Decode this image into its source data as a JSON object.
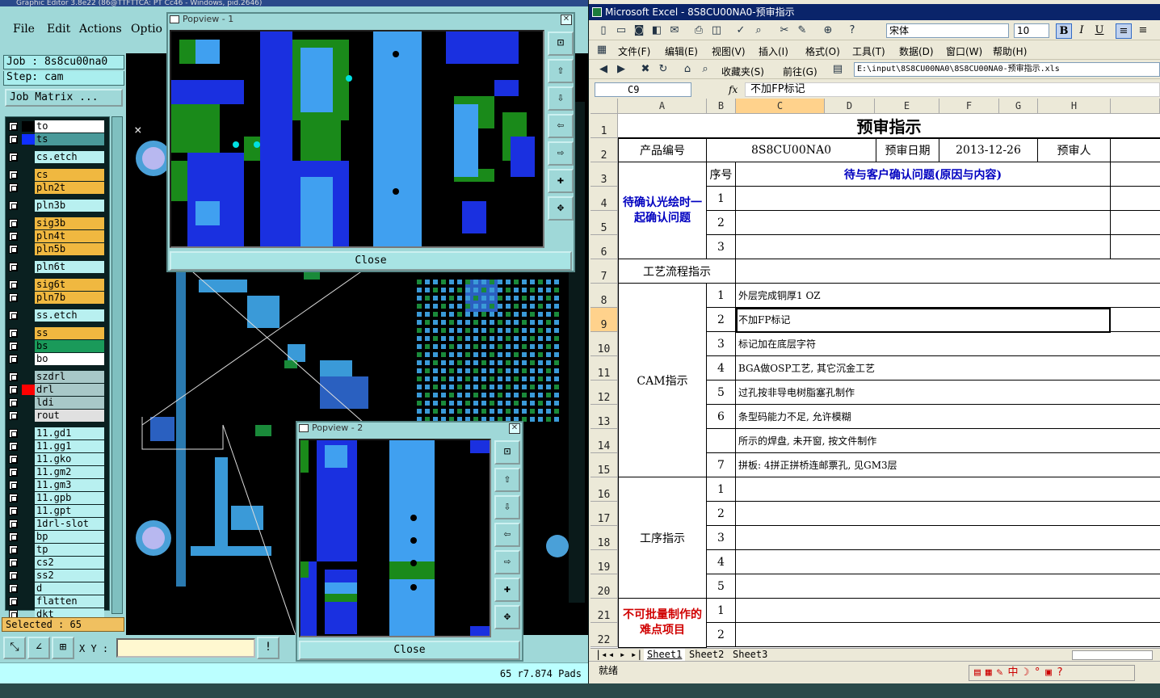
{
  "graphic_editor": {
    "title": "Graphic Editor 3.8e22 (86@TTFTTCA: PT Cc46 - Windows, pid.2646)",
    "menu": [
      "File",
      "Edit",
      "Actions",
      "Optio"
    ],
    "job_label": "Job : 8s8cu00na0",
    "step_label": "Step: cam",
    "job_matrix_button": "Job Matrix ...",
    "layers": [
      {
        "name": "to",
        "color": "#ffffff",
        "swatch": "#000000"
      },
      {
        "name": "ts",
        "color": "#4a9a9a",
        "swatch": "#1030ff"
      },
      {
        "name": "cs.etch",
        "color": "#b8f0f0",
        "swatch": ""
      },
      {
        "name": "cs",
        "color": "#f0b840",
        "swatch": ""
      },
      {
        "name": "pln2t",
        "color": "#f0b840",
        "swatch": ""
      },
      {
        "name": "pln3b",
        "color": "#b8f0f0",
        "swatch": ""
      },
      {
        "name": "sig3b",
        "color": "#f0b840",
        "swatch": ""
      },
      {
        "name": "pln4t",
        "color": "#f0b840",
        "swatch": ""
      },
      {
        "name": "pln5b",
        "color": "#f0b840",
        "swatch": ""
      },
      {
        "name": "pln6t",
        "color": "#b8f0f0",
        "swatch": ""
      },
      {
        "name": "sig6t",
        "color": "#f0b840",
        "swatch": ""
      },
      {
        "name": "pln7b",
        "color": "#f0b840",
        "swatch": ""
      },
      {
        "name": "ss.etch",
        "color": "#b8f0f0",
        "swatch": ""
      },
      {
        "name": "ss",
        "color": "#f0b840",
        "swatch": ""
      },
      {
        "name": "bs",
        "color": "#1a9a5a",
        "swatch": ""
      },
      {
        "name": "bo",
        "color": "#ffffff",
        "swatch": ""
      },
      {
        "name": "szdrl",
        "color": "#a8c8c8",
        "swatch": ""
      },
      {
        "name": "drl",
        "color": "#a8c8c8",
        "swatch": "#ff0000"
      },
      {
        "name": "ldi",
        "color": "#a8c8c8",
        "swatch": ""
      },
      {
        "name": "rout",
        "color": "#e0e0e0",
        "swatch": ""
      },
      {
        "name": "11.gd1",
        "color": "#b8f0f0",
        "swatch": ""
      },
      {
        "name": "11.gg1",
        "color": "#b8f0f0",
        "swatch": ""
      },
      {
        "name": "11.gko",
        "color": "#b8f0f0",
        "swatch": ""
      },
      {
        "name": "11.gm2",
        "color": "#b8f0f0",
        "swatch": ""
      },
      {
        "name": "11.gm3",
        "color": "#b8f0f0",
        "swatch": ""
      },
      {
        "name": "11.gpb",
        "color": "#b8f0f0",
        "swatch": ""
      },
      {
        "name": "11.gpt",
        "color": "#b8f0f0",
        "swatch": ""
      },
      {
        "name": "1drl-slot",
        "color": "#b8f0f0",
        "swatch": ""
      },
      {
        "name": "bp",
        "color": "#b8f0f0",
        "swatch": ""
      },
      {
        "name": "tp",
        "color": "#b8f0f0",
        "swatch": ""
      },
      {
        "name": "cs2",
        "color": "#b8f0f0",
        "swatch": ""
      },
      {
        "name": "ss2",
        "color": "#b8f0f0",
        "swatch": ""
      },
      {
        "name": "d",
        "color": "#b8f0f0",
        "swatch": ""
      },
      {
        "name": "flatten",
        "color": "#b8f0f0",
        "swatch": ""
      },
      {
        "name": "dkt",
        "color": "#b8f0f0",
        "swatch": ""
      }
    ],
    "selected_label": "Selected : 65",
    "xy_label": "X Y :",
    "status_text": "65 r7.874 Pads"
  },
  "popview1": {
    "title": "Popview - 1",
    "close_label": "Close"
  },
  "popview2": {
    "title": "Popview - 2",
    "close_label": "Close"
  },
  "excel": {
    "title": "Microsoft Excel - 8S8CU00NA0-预审指示",
    "menu": [
      "文件(F)",
      "编辑(E)",
      "视图(V)",
      "插入(I)",
      "格式(O)",
      "工具(T)",
      "数据(D)",
      "窗口(W)",
      "帮助(H)"
    ],
    "font_name": "宋体",
    "font_size": "10",
    "back_label": "收藏夹(S)",
    "go_label": "前往(G)",
    "path": "E:\\input\\8S8CU00NA0\\8S8CU00NA0-预审指示.xls",
    "name_box": "C9",
    "formula": "不加FP标记",
    "columns": [
      "A",
      "B",
      "C",
      "D",
      "E",
      "F",
      "G",
      "H"
    ],
    "rows": [
      "1",
      "2",
      "3",
      "4",
      "5",
      "6",
      "7",
      "8",
      "9",
      "10",
      "11",
      "12",
      "13",
      "14",
      "15",
      "16",
      "17",
      "18",
      "19",
      "20",
      "21",
      "22"
    ],
    "cells": {
      "title": "预审指示",
      "product_no_label": "产品编号",
      "product_no": "8S8CU00NA0",
      "review_date_label": "预审日期",
      "review_date": "2013-12-26",
      "reviewer_label": "预审人",
      "confirm_section": "待确认光绘时一起确认问题",
      "seq_label": "序号",
      "confirm_header": "待与客户确认问题(原因与内容)",
      "process_label": "工艺流程指示",
      "cam_label": "CAM指示",
      "cam_items": [
        {
          "no": "1",
          "text": "外层完成铜厚1 OZ"
        },
        {
          "no": "2",
          "text": "不加FP标记"
        },
        {
          "no": "3",
          "text": "标记加在底层字符"
        },
        {
          "no": "4",
          "text": "BGA做OSP工艺, 其它沉金工艺"
        },
        {
          "no": "5",
          "text": "过孔按非导电树脂塞孔制作"
        },
        {
          "no": "6",
          "text": "条型码能力不足, 允许模糊"
        },
        {
          "no": "",
          "text": "所示的焊盘, 未开窗, 按文件制作"
        },
        {
          "no": "7",
          "text": "拼板: 4拼正拼桥连邮票孔, 见GM3层"
        }
      ],
      "proc_label": "工序指示",
      "difficulty_label": "不可批量制作的难点项目"
    },
    "sheets": [
      "Sheet1",
      "Sheet2",
      "Sheet3"
    ],
    "status": "就绪"
  }
}
